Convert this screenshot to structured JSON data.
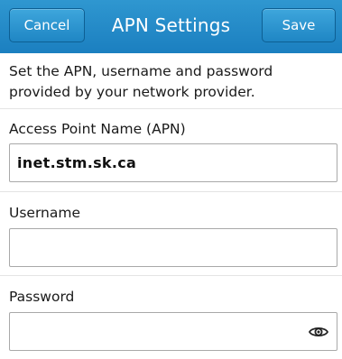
{
  "header": {
    "title": "APN Settings",
    "cancel_label": "Cancel",
    "save_label": "Save",
    "accent_color": "#1f86c4"
  },
  "instructions": "Set the APN, username and password provided by your network provider.",
  "fields": {
    "apn": {
      "label": "Access Point Name (APN)",
      "value": "inet.stm.sk.ca"
    },
    "username": {
      "label": "Username",
      "value": ""
    },
    "password": {
      "label": "Password",
      "value": "",
      "toggle_icon": "eye-icon"
    }
  }
}
